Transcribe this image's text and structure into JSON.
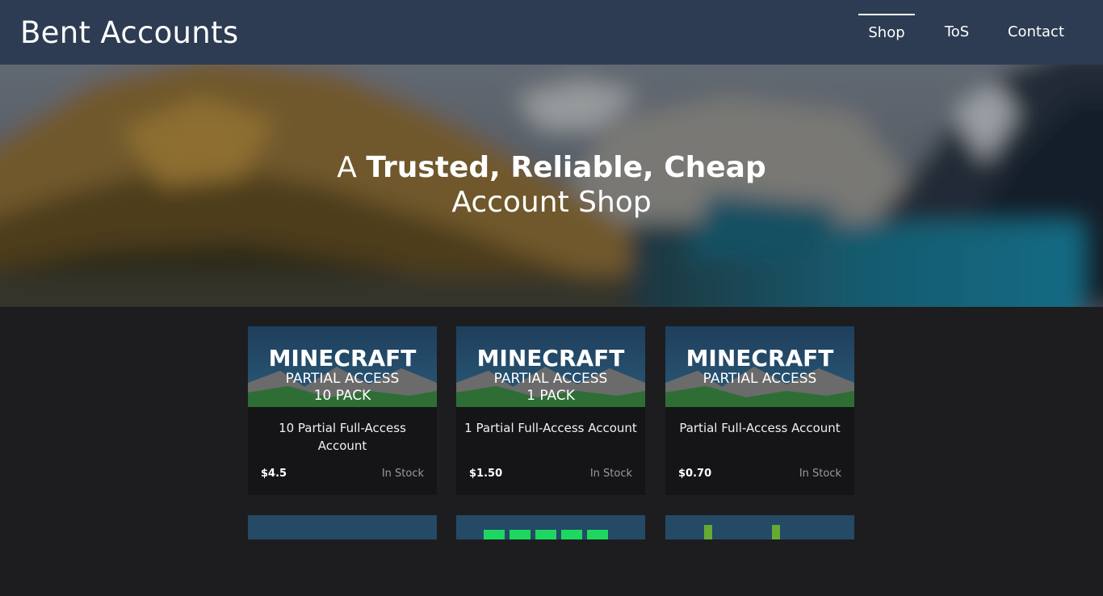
{
  "navbar": {
    "brand": "Bent Accounts",
    "links": [
      {
        "label": "Shop",
        "active": true
      },
      {
        "label": "ToS",
        "active": false
      },
      {
        "label": "Contact",
        "active": false
      }
    ]
  },
  "hero": {
    "prefix": "A",
    "emphasis": "Trusted, Reliable, Cheap",
    "line2": "Account Shop"
  },
  "products": [
    {
      "image_title": "MINECRAFT",
      "image_sub": "PARTIAL ACCESS",
      "image_pack": "10 PACK",
      "title": "10 Partial Full-Access Account",
      "price": "$4.5",
      "stock": "In Stock"
    },
    {
      "image_title": "MINECRAFT",
      "image_sub": "PARTIAL ACCESS",
      "image_pack": "1 PACK",
      "title": "1 Partial Full-Access Account",
      "price": "$1.50",
      "stock": "In Stock"
    },
    {
      "image_title": "MINECRAFT",
      "image_sub": "PARTIAL ACCESS",
      "image_pack": "",
      "title": "Partial Full-Access Account",
      "price": "$0.70",
      "stock": "In Stock"
    }
  ],
  "colors": {
    "navbar_bg": "#2d3c52",
    "page_bg": "#1d1d1f",
    "card_bg": "#151517",
    "stock_text": "#9a9a9a",
    "spotify_green": "#1ed760",
    "hulu_green": "#66aa33"
  }
}
